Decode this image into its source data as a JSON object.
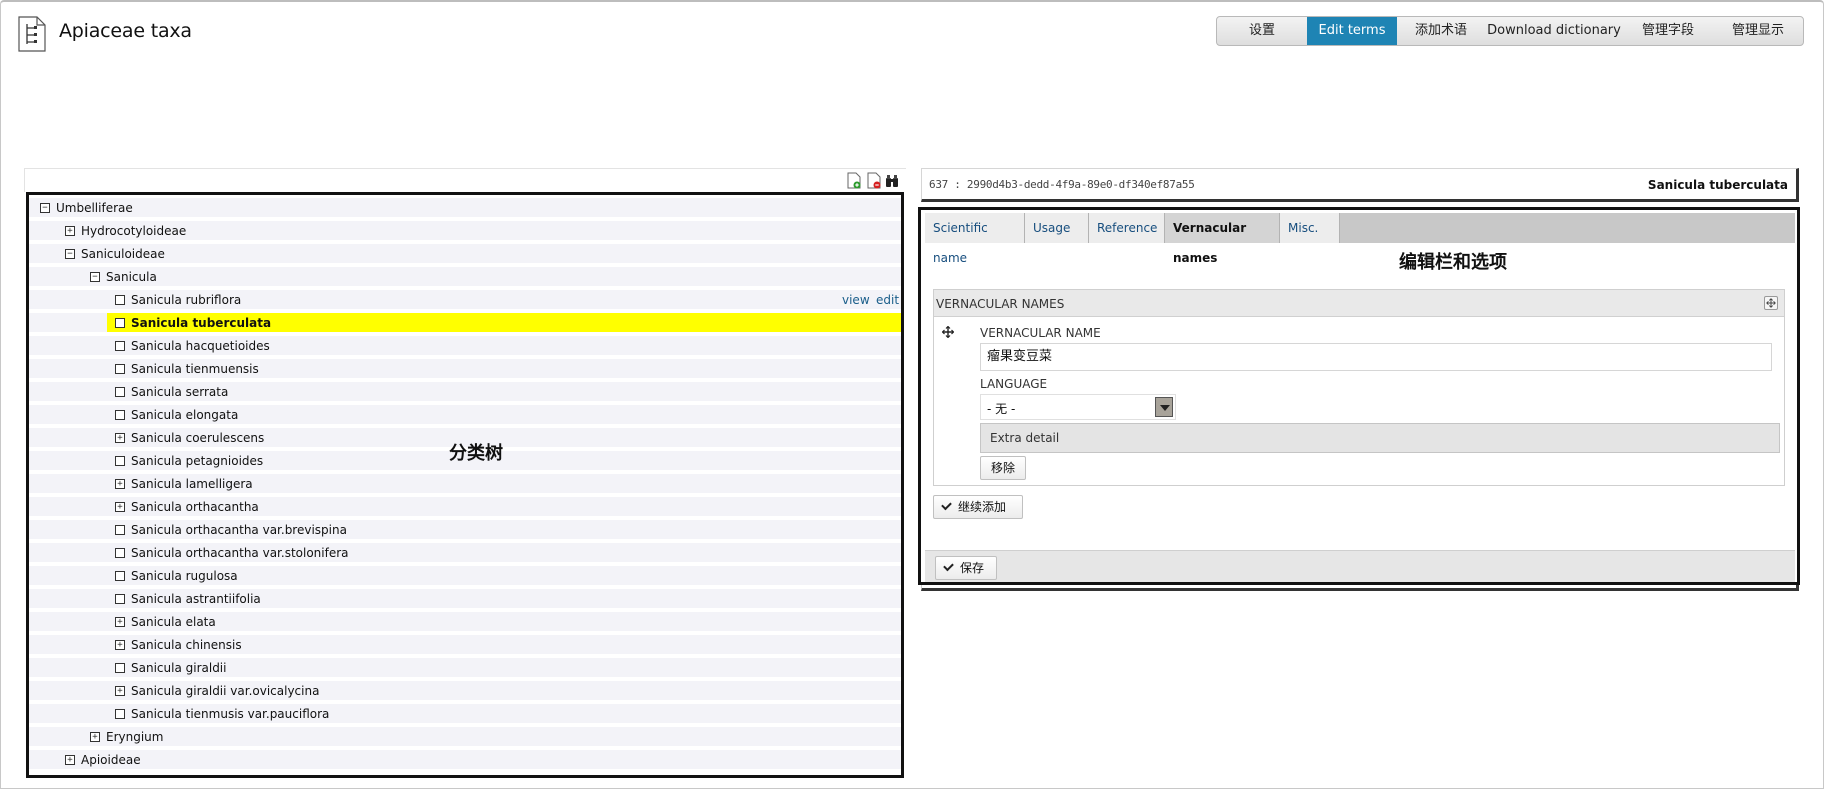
{
  "app": {
    "title": "Apiaceae taxa"
  },
  "nav": {
    "items": [
      {
        "label": "设置",
        "active": false
      },
      {
        "label": "Edit terms",
        "active": true
      },
      {
        "label": "添加术语",
        "active": false
      },
      {
        "label": "Download dictionary",
        "active": false
      },
      {
        "label": "管理字段",
        "active": false
      },
      {
        "label": "管理显示",
        "active": false
      }
    ]
  },
  "toolbar": {
    "icons": [
      "add-document-icon",
      "delete-document-icon",
      "binoculars-icon"
    ]
  },
  "tree": {
    "annotation": "分类树",
    "selected": "Sanicula tuberculata",
    "row_links": {
      "view": "view",
      "edit": "edit"
    },
    "rows": [
      {
        "label": "Umbelliferae",
        "toggle": "minus"
      },
      {
        "label": "Hydrocotyloideae",
        "toggle": "plus"
      },
      {
        "label": "Saniculoideae",
        "toggle": "minus"
      },
      {
        "label": "Sanicula",
        "toggle": "minus"
      },
      {
        "label": "Sanicula rubriflora",
        "toggle": "leaf"
      },
      {
        "label": "Sanicula tuberculata",
        "toggle": "leaf"
      },
      {
        "label": "Sanicula hacquetioides",
        "toggle": "leaf"
      },
      {
        "label": "Sanicula tienmuensis",
        "toggle": "leaf"
      },
      {
        "label": "Sanicula serrata",
        "toggle": "leaf"
      },
      {
        "label": "Sanicula elongata",
        "toggle": "leaf"
      },
      {
        "label": "Sanicula coerulescens",
        "toggle": "plus"
      },
      {
        "label": "Sanicula petagnioides",
        "toggle": "leaf"
      },
      {
        "label": "Sanicula lamelligera",
        "toggle": "plus"
      },
      {
        "label": "Sanicula orthacantha",
        "toggle": "plus"
      },
      {
        "label": "Sanicula orthacantha var.brevispina",
        "toggle": "leaf"
      },
      {
        "label": "Sanicula orthacantha var.stolonifera",
        "toggle": "leaf"
      },
      {
        "label": "Sanicula rugulosa",
        "toggle": "leaf"
      },
      {
        "label": "Sanicula astrantiifolia",
        "toggle": "leaf"
      },
      {
        "label": "Sanicula elata",
        "toggle": "plus"
      },
      {
        "label": "Sanicula chinensis",
        "toggle": "plus"
      },
      {
        "label": "Sanicula giraldii",
        "toggle": "leaf"
      },
      {
        "label": "Sanicula giraldii var.ovicalycina",
        "toggle": "plus"
      },
      {
        "label": "Sanicula tienmusis var.pauciflora",
        "toggle": "leaf"
      },
      {
        "label": "Eryngium",
        "toggle": "plus"
      },
      {
        "label": "Apioideae",
        "toggle": "plus"
      }
    ]
  },
  "record": {
    "id": "637 : 2990d4b3-dedd-4f9a-89e0-df340ef87a55",
    "name": "Sanicula tuberculata"
  },
  "editor": {
    "annotation": "编辑栏和选项",
    "tabs": [
      {
        "label": "Scientific name",
        "active": false
      },
      {
        "label": "Usage",
        "active": false
      },
      {
        "label": "Reference",
        "active": false
      },
      {
        "label": "Vernacular names",
        "active": true
      },
      {
        "label": "Misc.",
        "active": false
      }
    ],
    "vernacular": {
      "section_title": "VERNACULAR NAMES",
      "name_label": "VERNACULAR NAME",
      "name_value": "瘤果变豆菜",
      "language_label": "LANGUAGE",
      "language_value": "- 无 -",
      "extra_detail": "Extra detail",
      "remove_label": "移除"
    },
    "add_more_label": "继续添加",
    "save_label": "保存"
  }
}
